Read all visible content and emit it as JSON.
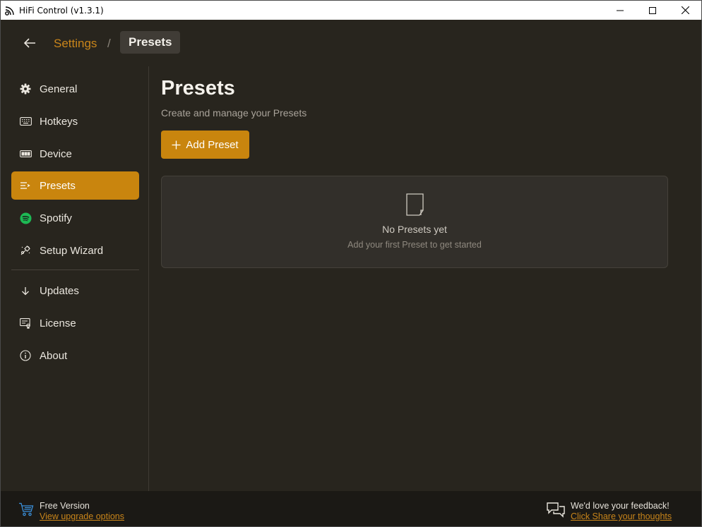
{
  "window": {
    "title": "HiFi Control (v1.3.1)"
  },
  "breadcrumb": {
    "parent": "Settings",
    "separator": "/",
    "current": "Presets"
  },
  "sidebar": {
    "items": [
      {
        "label": "General",
        "icon": "gear-icon"
      },
      {
        "label": "Hotkeys",
        "icon": "keyboard-icon"
      },
      {
        "label": "Device",
        "icon": "device-icon"
      },
      {
        "label": "Presets",
        "icon": "presets-icon",
        "active": true
      },
      {
        "label": "Spotify",
        "icon": "spotify-icon"
      },
      {
        "label": "Setup Wizard",
        "icon": "wizard-icon"
      }
    ],
    "secondary_items": [
      {
        "label": "Updates",
        "icon": "arrow-down-icon"
      },
      {
        "label": "License",
        "icon": "license-icon"
      },
      {
        "label": "About",
        "icon": "info-icon"
      }
    ]
  },
  "main": {
    "title": "Presets",
    "subtitle": "Create and manage your Presets",
    "add_button_label": "Add Preset",
    "empty_state": {
      "title": "No Presets yet",
      "description": "Add your first Preset to get started"
    }
  },
  "footer": {
    "version_label": "Free Version",
    "upgrade_link": "View upgrade options",
    "feedback_label": "We'd love your feedback!",
    "feedback_link": "Click Share your thoughts"
  },
  "colors": {
    "accent": "#c9850e",
    "background": "#28251e",
    "card": "#322f2a",
    "footer": "#1b1915",
    "spotify_green": "#1db954"
  }
}
